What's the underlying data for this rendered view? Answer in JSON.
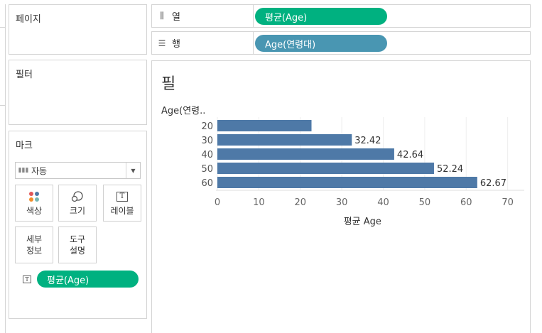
{
  "panels": {
    "pages": "페이지",
    "filters": "필터",
    "marks": "마크"
  },
  "shelves": {
    "columns": {
      "label": "열",
      "pill": "평균(Age)"
    },
    "rows": {
      "label": "행",
      "pill": "Age(연령대)"
    }
  },
  "marks_card": {
    "mark_type": "자동",
    "buttons": {
      "color": "색상",
      "size": "크기",
      "label": "레이블",
      "detail_line1": "세부",
      "detail_line2": "정보",
      "tooltip_line1": "도구",
      "tooltip_line2": "설명"
    },
    "label_pill": "평균(Age)"
  },
  "colors": {
    "bar": "#4e79a7",
    "pill_green": "#00b180",
    "pill_blue": "#4996b2",
    "dot_colors": [
      "#e15759",
      "#4e79a7",
      "#f28e2b",
      "#76b7b2"
    ]
  },
  "sheet": {
    "title": "필"
  },
  "chart_data": {
    "type": "bar",
    "orientation": "horizontal",
    "row_header": "Age(연령..",
    "categories": [
      "20",
      "30",
      "40",
      "50",
      "60"
    ],
    "values": [
      22.7,
      32.42,
      42.64,
      52.24,
      62.67
    ],
    "data_labels": [
      "",
      "32.42",
      "42.64",
      "52.24",
      "62.67"
    ],
    "x_ticks": [
      0,
      10,
      20,
      30,
      40,
      50,
      60,
      70
    ],
    "xlim": [
      0,
      74
    ],
    "xlabel": "평균 Age",
    "grid": true
  }
}
